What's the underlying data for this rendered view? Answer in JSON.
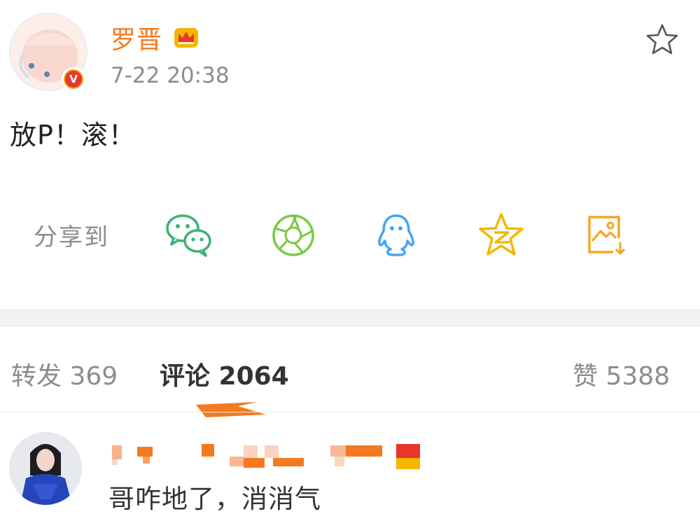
{
  "post": {
    "author": "罗晋",
    "time": "7-22 20:38",
    "text": "放P！滚！"
  },
  "share": {
    "label": "分享到",
    "targets": [
      {
        "name": "wechat",
        "color": "#3cb371"
      },
      {
        "name": "moments",
        "color": "#7ac943"
      },
      {
        "name": "qq",
        "color": "#43a5f5"
      },
      {
        "name": "qzone",
        "color": "#f5b700"
      },
      {
        "name": "save-image",
        "color": "#f5a623"
      }
    ]
  },
  "tabs": {
    "repost": "转发 369",
    "comment": "评论 2064",
    "like": "赞 5388"
  },
  "comment": {
    "text": "哥咋地了，消消气"
  },
  "colors": {
    "accent": "#f47a1f",
    "muted": "#8c8c8c"
  }
}
